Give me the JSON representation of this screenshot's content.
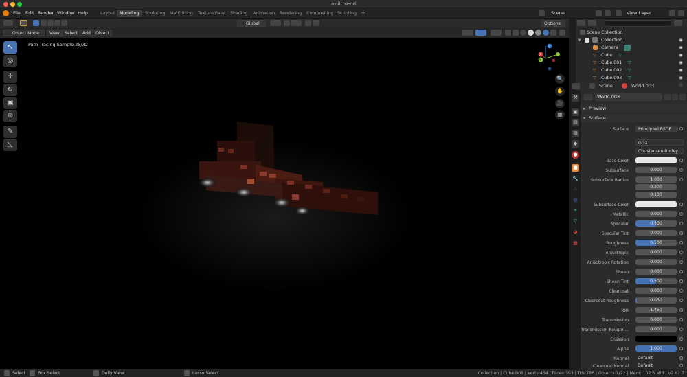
{
  "window": {
    "title": "rmit.blend"
  },
  "menu": {
    "items": [
      "File",
      "Edit",
      "Render",
      "Window",
      "Help"
    ]
  },
  "workspaces": {
    "tabs": [
      "Layout",
      "Modeling",
      "Sculpting",
      "UV Editing",
      "Texture Paint",
      "Shading",
      "Animation",
      "Rendering",
      "Compositing",
      "Scripting"
    ],
    "active": "Modeling",
    "add": "+"
  },
  "scene": {
    "name": "Scene"
  },
  "view_layer": {
    "name": "View Layer"
  },
  "viewport_header": {
    "mode": "Object Mode",
    "menus": [
      "View",
      "Select",
      "Add",
      "Object"
    ],
    "orientation": "Global",
    "options": "Options"
  },
  "viewport": {
    "sample_text": "Path Tracing Sample 25/32"
  },
  "gizmo": {
    "x": "X",
    "y": "Y",
    "z": "Z"
  },
  "outliner": {
    "root": "Scene Collection",
    "collection": "Collection",
    "items": [
      "Camera",
      "Cube",
      "Cube.001",
      "Cube.002",
      "Cube.003"
    ]
  },
  "properties_header": {
    "scene": "Scene",
    "world": "World.003"
  },
  "world_block": {
    "name": "World.003"
  },
  "panels": {
    "preview": "Preview",
    "surface": "Surface"
  },
  "surface": {
    "shader_label": "Surface",
    "shader": "Principled BSDF",
    "distribution": "GGX",
    "subsurface_method": "Christensen-Burley",
    "base_color_label": "Base Color",
    "base_color": "#e8e8e8",
    "subsurface_label": "Subsurface",
    "subsurface": "0.000",
    "subsurface_radius_label": "Subsurface Radius",
    "subsurface_radius": [
      "1.000",
      "0.200",
      "0.100"
    ],
    "subsurface_color_label": "Subsurface Color",
    "subsurface_color": "#e8e8e8",
    "metallic_label": "Metallic",
    "metallic": "0.000",
    "specular_label": "Specular",
    "specular": "0.500",
    "specular_fill": 0.5,
    "specular_tint_label": "Specular Tint",
    "specular_tint": "0.000",
    "roughness_label": "Roughness",
    "roughness": "0.500",
    "roughness_fill": 0.5,
    "anisotropic_label": "Anisotropic",
    "anisotropic": "0.000",
    "anisotropic_rotation_label": "Anisotropic Rotation",
    "anisotropic_rotation": "0.000",
    "sheen_label": "Sheen",
    "sheen": "0.000",
    "sheen_tint_label": "Sheen Tint",
    "sheen_tint": "0.500",
    "sheen_tint_fill": 0.5,
    "clearcoat_label": "Clearcoat",
    "clearcoat": "0.000",
    "clearcoat_roughness_label": "Clearcoat Roughness",
    "clearcoat_roughness": "0.030",
    "clearcoat_roughness_fill": 0.03,
    "ior_label": "IOR",
    "ior": "1.450",
    "transmission_label": "Transmission",
    "transmission": "0.000",
    "transmission_roughness_label": "Transmission Roughn...",
    "transmission_roughness": "0.000",
    "emission_label": "Emission",
    "emission": "#000000",
    "alpha_label": "Alpha",
    "alpha": "1.000",
    "alpha_fill": 1.0,
    "normal_label": "Normal",
    "normal": "Default",
    "clearcoat_normal_label": "Clearcoat Normal",
    "clearcoat_normal": "Default"
  },
  "status": {
    "select": "Select",
    "box_select": "Box Select",
    "dolly_view": "Dolly View",
    "lasso_select": "Lasso Select",
    "info": "Collection | Cube.008 | Verts:464 | Faces:393 | Tris:786 | Objects:1/22 | Mem: 102.5 MiB | v2.82.7"
  },
  "colors": {
    "accent": "#4772b3",
    "field": "#545454",
    "panel": "#2b2b2b",
    "close": "#ff5f57",
    "minimize": "#febc2e",
    "zoom": "#28c840"
  }
}
